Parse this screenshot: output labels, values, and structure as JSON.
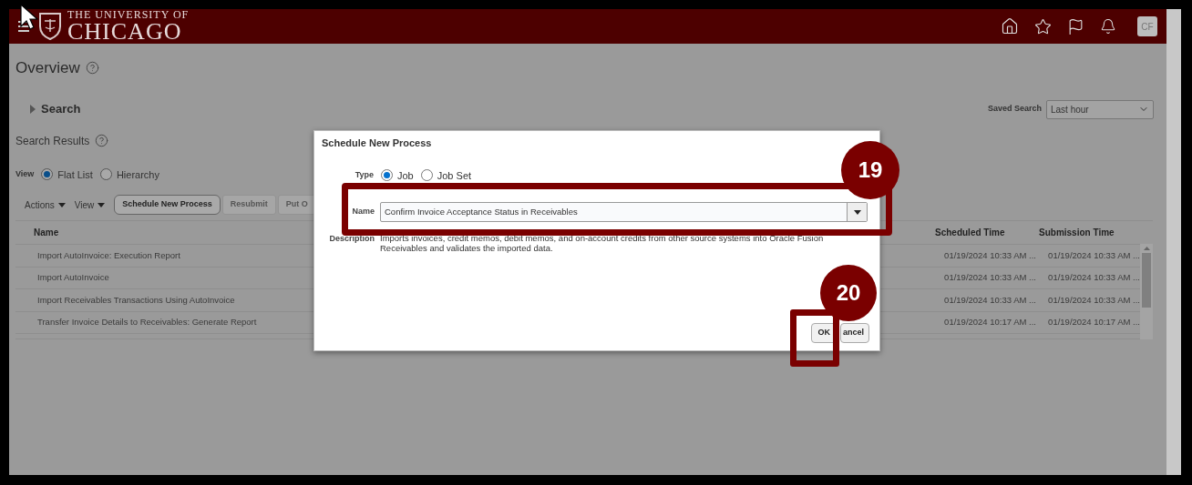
{
  "header": {
    "logo_top": "THE UNIVERSITY OF",
    "logo_bottom": "CHICAGO",
    "avatar": "CF"
  },
  "page_title": "Overview",
  "search": {
    "label": "Search",
    "expanded": false
  },
  "saved_search": {
    "label": "Saved Search",
    "value": "Last hour"
  },
  "results_title": "Search Results",
  "view": {
    "label": "View",
    "options": [
      {
        "label": "Flat List",
        "selected": true
      },
      {
        "label": "Hierarchy",
        "selected": false
      }
    ]
  },
  "toolbar": {
    "menus": [
      "Actions",
      "View"
    ],
    "buttons": [
      {
        "label": "Schedule New Process",
        "disabled": false
      },
      {
        "label": "Resubmit",
        "disabled": true
      },
      {
        "label": "Put O",
        "disabled": true
      }
    ]
  },
  "table": {
    "columns": [
      "Name",
      "Scheduled Time",
      "Submission Time"
    ],
    "rows": [
      {
        "name": "Import AutoInvoice: Execution Report",
        "scheduled": "01/19/2024 10:33 AM ...",
        "submission": "01/19/2024 10:33 AM ..."
      },
      {
        "name": "Import AutoInvoice",
        "scheduled": "01/19/2024 10:33 AM ...",
        "submission": "01/19/2024 10:33 AM ..."
      },
      {
        "name": "Import Receivables Transactions Using AutoInvoice",
        "scheduled": "01/19/2024 10:33 AM ...",
        "submission": "01/19/2024 10:33 AM ..."
      },
      {
        "name": "Transfer Invoice Details to Receivables: Generate Report",
        "scheduled": "01/19/2024 10:17 AM ...",
        "submission": "01/19/2024 10:17 AM ..."
      }
    ]
  },
  "dialog": {
    "title": "Schedule New Process",
    "type_label": "Type",
    "type_options": [
      {
        "label": "Job",
        "selected": true
      },
      {
        "label": "Job Set",
        "selected": false
      }
    ],
    "name_label": "Name",
    "name_value": "Confirm Invoice Acceptance Status in Receivables",
    "description_label": "Description",
    "description": "Imports invoices, credit memos, debit memos, and on-account credits from other source systems into Oracle Fusion Receivables and validates the imported data.",
    "buttons": [
      "OK",
      "ancel"
    ]
  },
  "annotations": [
    {
      "number": "19"
    },
    {
      "number": "20"
    }
  ]
}
